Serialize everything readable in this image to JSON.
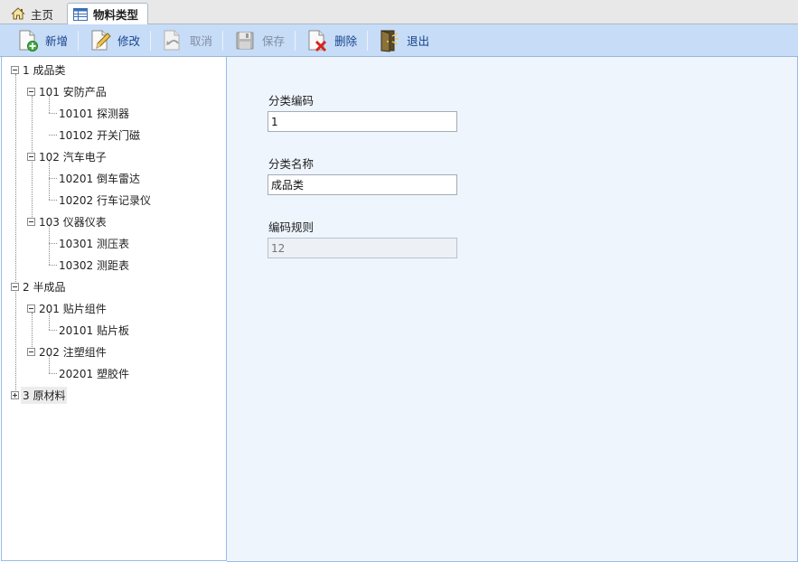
{
  "tabs": [
    {
      "label": "主页",
      "icon": "home-icon"
    },
    {
      "label": "物料类型",
      "icon": "table-icon",
      "active": true
    }
  ],
  "toolbar": {
    "new_label": "新增",
    "edit_label": "修改",
    "cancel_label": "取消",
    "save_label": "保存",
    "delete_label": "删除",
    "exit_label": "退出"
  },
  "tree": {
    "nodes": [
      {
        "label": "1 成品类",
        "level": 0,
        "expanded": true
      },
      {
        "label": "101 安防产品",
        "level": 1,
        "expanded": true
      },
      {
        "label": "10101 探测器",
        "level": 2
      },
      {
        "label": "10102 开关门磁",
        "level": 2
      },
      {
        "label": "102 汽车电子",
        "level": 1,
        "expanded": true
      },
      {
        "label": "10201 倒车雷达",
        "level": 2
      },
      {
        "label": "10202 行车记录仪",
        "level": 2
      },
      {
        "label": "103 仪器仪表",
        "level": 1,
        "expanded": true
      },
      {
        "label": "10301 测压表",
        "level": 2
      },
      {
        "label": "10302 测距表",
        "level": 2
      },
      {
        "label": "2 半成品",
        "level": 0,
        "expanded": true
      },
      {
        "label": "201 贴片组件",
        "level": 1,
        "expanded": true
      },
      {
        "label": "20101 贴片板",
        "level": 2
      },
      {
        "label": "202 注塑组件",
        "level": 1,
        "expanded": true
      },
      {
        "label": "20201 塑胶件",
        "level": 2
      },
      {
        "label": "3 原材料",
        "level": 0,
        "expanded": false,
        "selected": true
      }
    ]
  },
  "form": {
    "code_label": "分类编码",
    "code_value": "1",
    "name_label": "分类名称",
    "name_value": "成品类",
    "rule_label": "编码规则",
    "rule_placeholder": "12"
  },
  "colors": {
    "toolbar_bg": "#c7dcf7",
    "form_bg": "#eef5fd",
    "toolbar_text": "#15428b"
  }
}
